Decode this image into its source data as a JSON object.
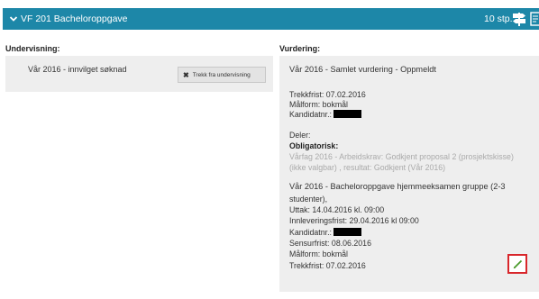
{
  "header": {
    "title": "VF 201 Bacheloroppgave",
    "credits": "10 stp.",
    "bg_color": "#1d87a8",
    "icons": [
      "chevron-down-icon",
      "signpost-icon",
      "document-edit-icon"
    ]
  },
  "left": {
    "heading": "Undervisning:",
    "course": "Vår 2016 - innvilget søknad",
    "withdraw_label": "Trekk fra undervisning"
  },
  "right": {
    "heading": "Vurdering:",
    "summary": "Vår 2016 - Samlet vurdering - Oppmeldt",
    "trekkfrist": "Trekkfrist: 07.02.2016",
    "malform": "Målform: bokmål",
    "kandidatnr_label": "Kandidatnr.:",
    "deler": "Deler:",
    "obligatorisk": "Obligatorisk:",
    "arbeidskrav_line1": "Vårfag 2016 - Arbeidskrav: Godkjent proposal 2 (prosjektskisse)",
    "arbeidskrav_line2": "(ikke valgbar) , resultat: Godkjent (Vår 2016)",
    "exam_line1": "Vår 2016 - Bacheloroppgave hjemmeeksamen gruppe (2-3",
    "exam_line2": "studenter),",
    "uttak": "Uttak: 14.04.2016 kl. 09:00",
    "innlevering": "Innleveringsfrist: 29.04.2016 kl 09:00",
    "kandidatnr2_label": "Kandidatnr.:",
    "sensurfrist": "Sensurfrist: 08.06.2016",
    "malform2": "Målform: bokmål",
    "trekkfrist2": "Trekkfrist: 07.02.2016"
  },
  "edit": {
    "icon": "pencil-icon",
    "highlight_color": "#d8262b"
  }
}
